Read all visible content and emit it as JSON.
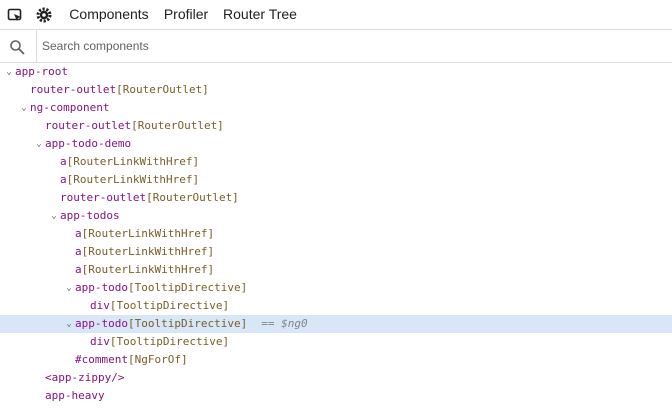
{
  "toolbar": {
    "inspect_icon": "inspect-element-icon",
    "settings_icon": "gear-icon",
    "tabs": [
      {
        "label": "Components",
        "active": true
      },
      {
        "label": "Profiler",
        "active": false
      },
      {
        "label": "Router Tree",
        "active": false
      }
    ]
  },
  "search": {
    "icon": "search-icon",
    "placeholder": "Search components",
    "value": ""
  },
  "colors": {
    "accent": "#1a73e8",
    "component_name": "#881280",
    "directive": "#795e26",
    "selected_row": "#d7e7f7",
    "border": "#dadce0"
  },
  "tree": {
    "nodes": [
      {
        "name": "app-root",
        "directives": "",
        "caret": "expanded",
        "depth": 0
      },
      {
        "name": "router-outlet",
        "directives": "[RouterOutlet]",
        "caret": "none",
        "depth": 1
      },
      {
        "name": "ng-component",
        "directives": "",
        "caret": "expanded",
        "depth": 1
      },
      {
        "name": "router-outlet",
        "directives": "[RouterOutlet]",
        "caret": "none",
        "depth": 2
      },
      {
        "name": "app-todo-demo",
        "directives": "",
        "caret": "expanded",
        "depth": 2
      },
      {
        "name": "a",
        "directives": "[RouterLinkWithHref]",
        "caret": "none",
        "depth": 3
      },
      {
        "name": "a",
        "directives": "[RouterLinkWithHref]",
        "caret": "none",
        "depth": 3
      },
      {
        "name": "router-outlet",
        "directives": "[RouterOutlet]",
        "caret": "none",
        "depth": 3
      },
      {
        "name": "app-todos",
        "directives": "",
        "caret": "expanded",
        "depth": 3
      },
      {
        "name": "a",
        "directives": "[RouterLinkWithHref]",
        "caret": "none",
        "depth": 4
      },
      {
        "name": "a",
        "directives": "[RouterLinkWithHref]",
        "caret": "none",
        "depth": 4
      },
      {
        "name": "a",
        "directives": "[RouterLinkWithHref]",
        "caret": "none",
        "depth": 4
      },
      {
        "name": "app-todo",
        "directives": "[TooltipDirective]",
        "caret": "expanded",
        "depth": 4
      },
      {
        "name": "div",
        "directives": "[TooltipDirective]",
        "caret": "none",
        "depth": 5
      },
      {
        "name": "app-todo",
        "directives": "[TooltipDirective]",
        "caret": "expanded",
        "depth": 4,
        "selected": true,
        "ref": "== $ng0"
      },
      {
        "name": "div",
        "directives": "[TooltipDirective]",
        "caret": "none",
        "depth": 5
      },
      {
        "name": "#comment",
        "directives": "[NgForOf]",
        "caret": "none",
        "depth": 4
      },
      {
        "name": "<app-zippy/>",
        "directives": "",
        "caret": "none",
        "depth": 2,
        "tag": true
      },
      {
        "name": "app-heavy",
        "directives": "",
        "caret": "none",
        "depth": 2
      }
    ]
  }
}
